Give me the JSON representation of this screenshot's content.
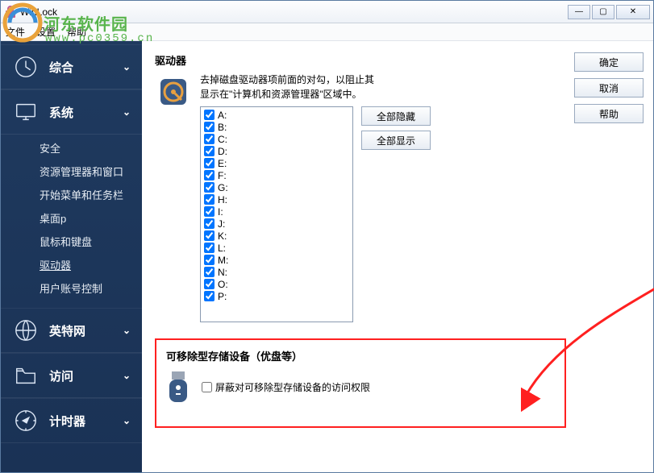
{
  "window": {
    "title": "WinLock",
    "min": "—",
    "max": "▢",
    "close": "✕"
  },
  "menu": {
    "file": "文件",
    "settings": "设置",
    "help": "帮助"
  },
  "sidebar": {
    "groups": [
      {
        "id": "general",
        "label": "综合",
        "chev": "⌄",
        "items": []
      },
      {
        "id": "system",
        "label": "系统",
        "chev": "⌄",
        "items": [
          {
            "id": "security",
            "label": "安全"
          },
          {
            "id": "explorer",
            "label": "资源管理器和窗口"
          },
          {
            "id": "startmenu",
            "label": "开始菜单和任务栏"
          },
          {
            "id": "desktop",
            "label": "桌面p"
          },
          {
            "id": "keyboard",
            "label": "鼠标和键盘"
          },
          {
            "id": "drives",
            "label": "驱动器",
            "active": true
          },
          {
            "id": "uac",
            "label": "用户账号控制"
          }
        ]
      },
      {
        "id": "internet",
        "label": "英特网",
        "chev": "⌄",
        "items": []
      },
      {
        "id": "access",
        "label": "访问",
        "chev": "⌄",
        "items": []
      },
      {
        "id": "timer",
        "label": "计时器",
        "chev": "⌄",
        "items": []
      }
    ]
  },
  "content": {
    "section_title": "驱动器",
    "desc1": "去掉磁盘驱动器项前面的对勾，以阻止其",
    "desc2": "显示在\"计算机和资源管理器\"区域中。",
    "drives": [
      "A:",
      "B:",
      "C:",
      "D:",
      "E:",
      "F:",
      "G:",
      "H:",
      "I:",
      "J:",
      "K:",
      "L:",
      "M:",
      "N:",
      "O:",
      "P:"
    ],
    "hide_all": "全部隐藏",
    "show_all": "全部显示",
    "removable_title": "可移除型存储设备（优盘等）",
    "removable_label": "屏蔽对可移除型存储设备的访问权限"
  },
  "buttons": {
    "ok": "确定",
    "cancel": "取消",
    "help": "帮助"
  },
  "watermark": {
    "text": "河东软件园",
    "url": "www.pc0359.cn"
  }
}
